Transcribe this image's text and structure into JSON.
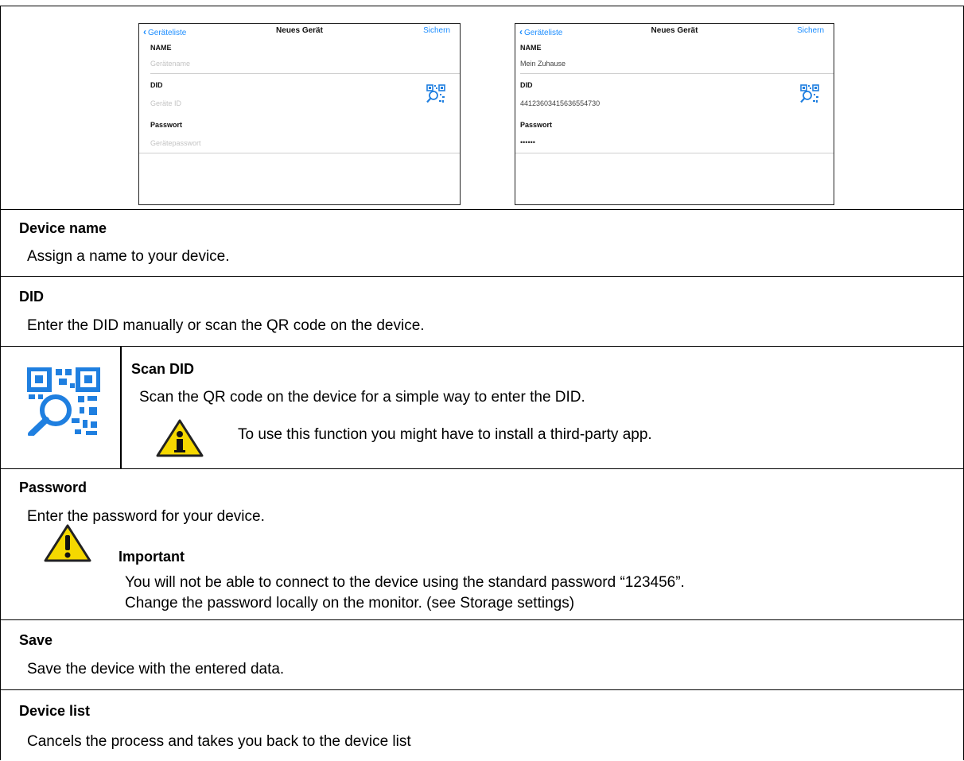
{
  "screens": {
    "left": {
      "back_label": "Geräteliste",
      "title": "Neues Gerät",
      "save_label": "Sichern",
      "name_label": "NAME",
      "name_value": "Gerätename",
      "did_label": "DID",
      "did_value": "Geräte ID",
      "password_label": "Passwort",
      "password_value": "Gerätepasswort"
    },
    "right": {
      "back_label": "Geräteliste",
      "title": "Neues Gerät",
      "save_label": "Sichern",
      "name_label": "NAME",
      "name_value": "Mein Zuhause",
      "did_label": "DID",
      "did_value": "44123603415636554730",
      "password_label": "Passwort",
      "password_value": "••••••"
    }
  },
  "sections": {
    "device_name": {
      "title": "Device name",
      "text": "Assign a name to your device."
    },
    "did": {
      "title": "DID",
      "text": "Enter the DID manually or scan the QR code on the device."
    },
    "scan_did": {
      "title": "Scan DID",
      "text": "Scan the QR code on the device for a simple way to enter the DID.",
      "note": "To use this function you might have to install a third-party app."
    },
    "password": {
      "title": "Password",
      "text": "Enter the password for your device.",
      "important_title": "Important",
      "important_line1": "You will not be able to connect to the device using the standard password “123456”.",
      "important_line2": "Change the password locally on the monitor. (see Storage settings)"
    },
    "save": {
      "title": "Save",
      "text": "Save the device with the entered data."
    },
    "device_list": {
      "title": "Device list",
      "text": "Cancels the process and takes you back to the device list"
    }
  },
  "colors": {
    "ios_blue": "#1a8cff",
    "qr_blue": "#1f7fe0",
    "warning_yellow": "#f5d800"
  },
  "icons": [
    "qr-scan-icon",
    "info-icon",
    "warning-icon",
    "chevron-left-icon"
  ]
}
